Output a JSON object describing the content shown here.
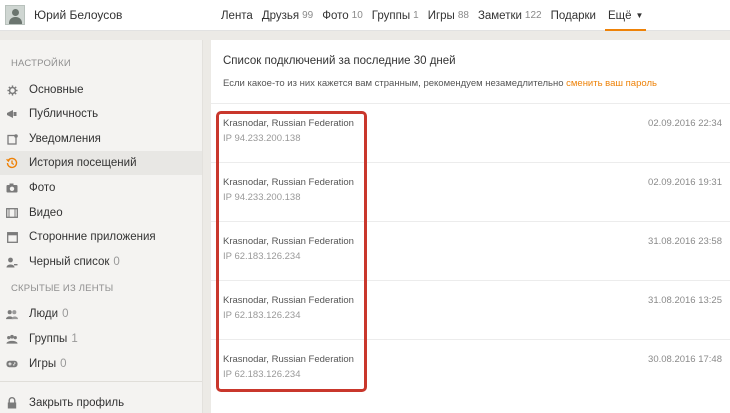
{
  "header": {
    "user_name": "Юрий Белоусов",
    "nav": [
      {
        "label": "Лента",
        "count": ""
      },
      {
        "label": "Друзья",
        "count": "99"
      },
      {
        "label": "Фото",
        "count": "10"
      },
      {
        "label": "Группы",
        "count": "1"
      },
      {
        "label": "Игры",
        "count": "88"
      },
      {
        "label": "Заметки",
        "count": "122"
      },
      {
        "label": "Подарки",
        "count": ""
      },
      {
        "label": "Ещё",
        "count": ""
      }
    ],
    "more_caret": "▼"
  },
  "sidebar": {
    "settings_title": "НАСТРОЙКИ",
    "items": [
      {
        "label": "Основные",
        "icon": "gear-icon",
        "count": ""
      },
      {
        "label": "Публичность",
        "icon": "megaphone-icon",
        "count": ""
      },
      {
        "label": "Уведомления",
        "icon": "notification-icon",
        "count": ""
      },
      {
        "label": "История посещений",
        "icon": "history-icon",
        "count": ""
      },
      {
        "label": "Фото",
        "icon": "camera-icon",
        "count": ""
      },
      {
        "label": "Видео",
        "icon": "film-icon",
        "count": ""
      },
      {
        "label": "Сторонние приложения",
        "icon": "apps-icon",
        "count": ""
      },
      {
        "label": "Черный список",
        "icon": "user-block-icon",
        "count": "0"
      }
    ],
    "hidden_title": "СКРЫТЫЕ ИЗ ЛЕНТЫ",
    "hidden_items": [
      {
        "label": "Люди",
        "icon": "people-icon",
        "count": "0"
      },
      {
        "label": "Группы",
        "icon": "groups-icon",
        "count": "1"
      },
      {
        "label": "Игры",
        "icon": "gamepad-icon",
        "count": "0"
      }
    ],
    "close_profile": {
      "label": "Закрыть профиль",
      "icon": "lock-icon"
    },
    "active_item": "История посещений",
    "accent_color": "#ee8208"
  },
  "main": {
    "heading": "Список подключений за последние 30 дней",
    "note": "Если какое-то из них кажется вам странным, рекомендуем незамедлительно",
    "note_link": "сменить ваш пароль",
    "sessions": [
      {
        "location": "Krasnodar, Russian Federation",
        "ip": "IP 94.233.200.138",
        "date": "02.09.2016 22:34"
      },
      {
        "location": "Krasnodar, Russian Federation",
        "ip": "IP 94.233.200.138",
        "date": "02.09.2016 19:31"
      },
      {
        "location": "Krasnodar, Russian Federation",
        "ip": "IP 62.183.126.234",
        "date": "31.08.2016 23:58"
      },
      {
        "location": "Krasnodar, Russian Federation",
        "ip": "IP 62.183.126.234",
        "date": "31.08.2016 13:25"
      },
      {
        "location": "Krasnodar, Russian Federation",
        "ip": "IP 62.183.126.234",
        "date": "30.08.2016 17:48"
      }
    ],
    "highlight_color": "#c9372c"
  }
}
